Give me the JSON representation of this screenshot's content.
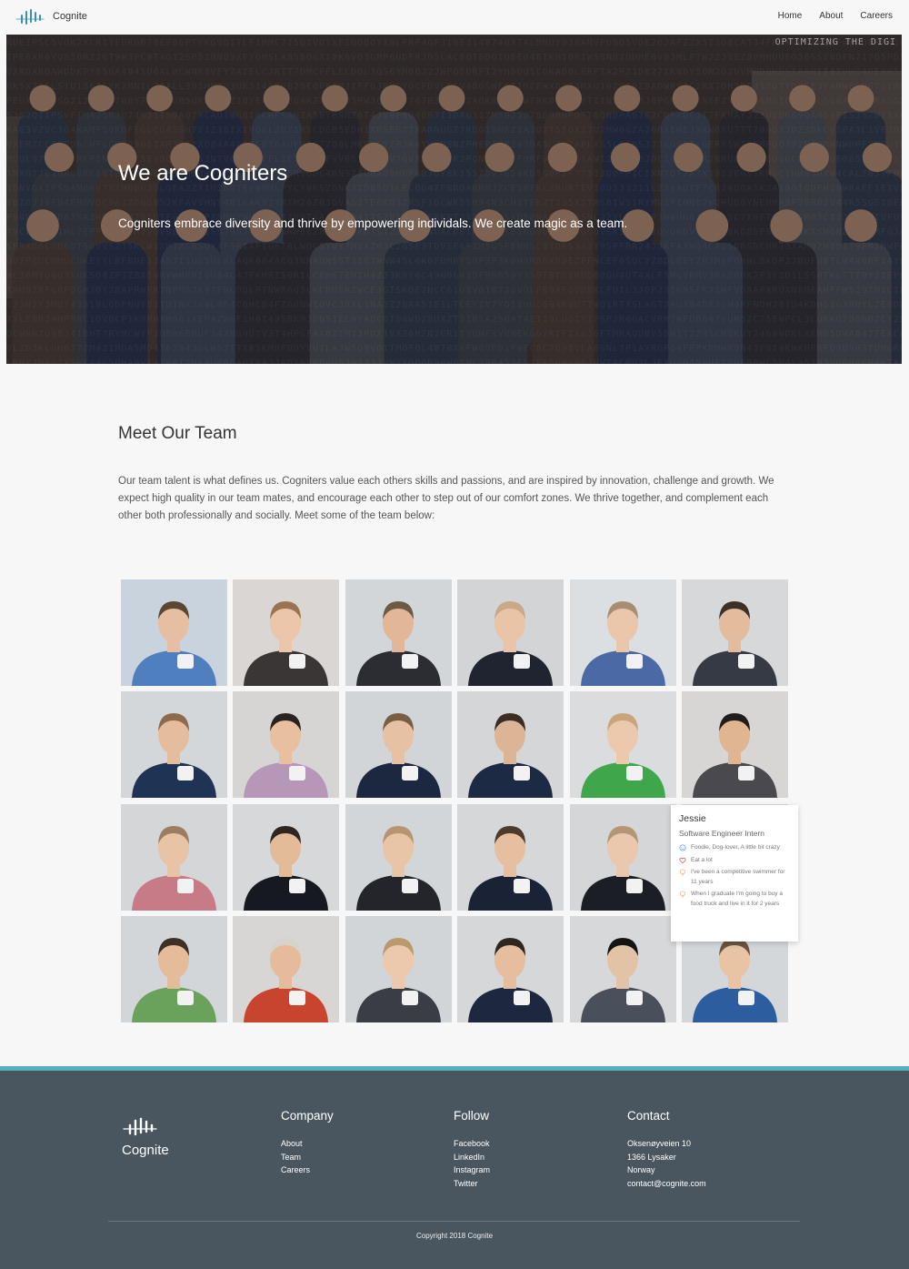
{
  "header": {
    "logo_text": "Cognite",
    "nav": [
      "Home",
      "About",
      "Careers"
    ]
  },
  "hero": {
    "title": "We are Cogniters",
    "subtitle": "Cogniters embrace diversity and thrive by empowering individals. We create magic as a team.",
    "corner_text": "OPTIMIZING THE DIGI"
  },
  "team": {
    "title": "Meet Our Team",
    "text": "Our team talent is what defines us. Cogniters value each others skills and passions, and are inspired by innovation, challenge and growth. We expect high quality in our team mates, and encourage each other to step out of our comfort zones. We thrive together, and complement each other both professionally and socially. Meet some of the team below:",
    "photos": [
      {
        "bg": "#c9d3dd",
        "shirt": "#4f7fbf",
        "skin": "#e6bfa2",
        "hair": "#5a4632"
      },
      {
        "bg": "#d9d6d3",
        "shirt": "#3a3636",
        "skin": "#ecc6aa",
        "hair": "#9b7350"
      },
      {
        "bg": "#d3d6d8",
        "shirt": "#2b2d33",
        "skin": "#e2b797",
        "hair": "#6b5a45"
      },
      {
        "bg": "#d2d4d6",
        "shirt": "#1f2430",
        "skin": "#e9c4a6",
        "hair": "#c9a98a"
      },
      {
        "bg": "#dcdfe2",
        "shirt": "#4b6aa5",
        "skin": "#eac7aa",
        "hair": "#a88e70"
      },
      {
        "bg": "#d6d8da",
        "shirt": "#353a44",
        "skin": "#e3bc9e",
        "hair": "#3c3027"
      },
      {
        "bg": "#d4d7da",
        "shirt": "#1f3354",
        "skin": "#e5bd9c",
        "hair": "#8c6b4c"
      },
      {
        "bg": "#d7d5d4",
        "shirt": "#b697b7",
        "skin": "#e8c09f",
        "hair": "#2a2220"
      },
      {
        "bg": "#d2d5d8",
        "shirt": "#1c2740",
        "skin": "#e6c1a3",
        "hair": "#7a5e44"
      },
      {
        "bg": "#d5d6d7",
        "shirt": "#1d2a44",
        "skin": "#dcb596",
        "hair": "#3b2d24"
      },
      {
        "bg": "#dadcde",
        "shirt": "#3fa64b",
        "skin": "#ecc9ad",
        "hair": "#caa57b"
      },
      {
        "bg": "#d7d6d5",
        "shirt": "#4a4a4e",
        "skin": "#e0b692",
        "hair": "#221d1c"
      },
      {
        "bg": "#d4d6d8",
        "shirt": "#c77b86",
        "skin": "#e8c3a5",
        "hair": "#9a7e62"
      },
      {
        "bg": "#d6d8da",
        "shirt": "#16191f",
        "skin": "#e3bb99",
        "hair": "#2f2620"
      },
      {
        "bg": "#d3d6d9",
        "shirt": "#23252b",
        "skin": "#e9c5a8",
        "hair": "#b89472"
      },
      {
        "bg": "#d5d7d9",
        "shirt": "#1a2236",
        "skin": "#e5bf9f",
        "hair": "#4c3a2c"
      },
      {
        "bg": "#d4d6d8",
        "shirt": "#1b1e24",
        "skin": "#e9c8ad",
        "hair": "#b49674"
      },
      {
        "bg": "#d6d7d8",
        "shirt": "#2c3140",
        "skin": "#e6c1a3",
        "hair": "#4a392b"
      },
      {
        "bg": "#d3d6d9",
        "shirt": "#6aa25c",
        "skin": "#e4bc9a",
        "hair": "#3f3025"
      },
      {
        "bg": "#d7d6d5",
        "shirt": "#c9442e",
        "skin": "#e6bb9b",
        "hair": "#d6d2cc"
      },
      {
        "bg": "#d2d5d8",
        "shirt": "#3a3d45",
        "skin": "#ecc9ad",
        "hair": "#b99a6f"
      },
      {
        "bg": "#d5d7d9",
        "shirt": "#1d2740",
        "skin": "#e4be9e",
        "hair": "#2f2620"
      },
      {
        "bg": "#d6d8da",
        "shirt": "#4a4f5c",
        "skin": "#e3c3a6",
        "hair": "#141414"
      },
      {
        "bg": "#d4d7da",
        "shirt": "#2c5d9e",
        "skin": "#e8c3a4",
        "hair": "#6b5440"
      }
    ]
  },
  "popup": {
    "name": "Jessie",
    "role": "Software Engineer Intern",
    "items": [
      {
        "icon": "smile-icon",
        "color": "#5b9bd5",
        "text": "Foodie, Dog-lover, A little bit crazy"
      },
      {
        "icon": "heart-icon",
        "color": "#d9534f",
        "text": "Eat a lot"
      },
      {
        "icon": "bulb-icon",
        "color": "#e8a85a",
        "text": "I've been a competitive swimmer for 11 years"
      },
      {
        "icon": "bulb-icon",
        "color": "#e8a85a",
        "text": "When I graduate I'm going to buy a food truck and live in it for 2 years"
      }
    ]
  },
  "footer": {
    "logo_text": "Cognite",
    "stripe_color": "#56b0c4",
    "columns": [
      {
        "title": "Company",
        "links": [
          "About",
          "Team",
          "Careers"
        ]
      },
      {
        "title": "Follow",
        "links": [
          "Facebook",
          "LinkedIn",
          "Instagram",
          "Twitter"
        ]
      },
      {
        "title": "Contact",
        "links": [
          "Oksenøyveien 10",
          "1366 Lysaker",
          "Norway",
          "contact@cognite.com"
        ]
      }
    ],
    "copyright": "Copyright 2018 Cognite"
  }
}
